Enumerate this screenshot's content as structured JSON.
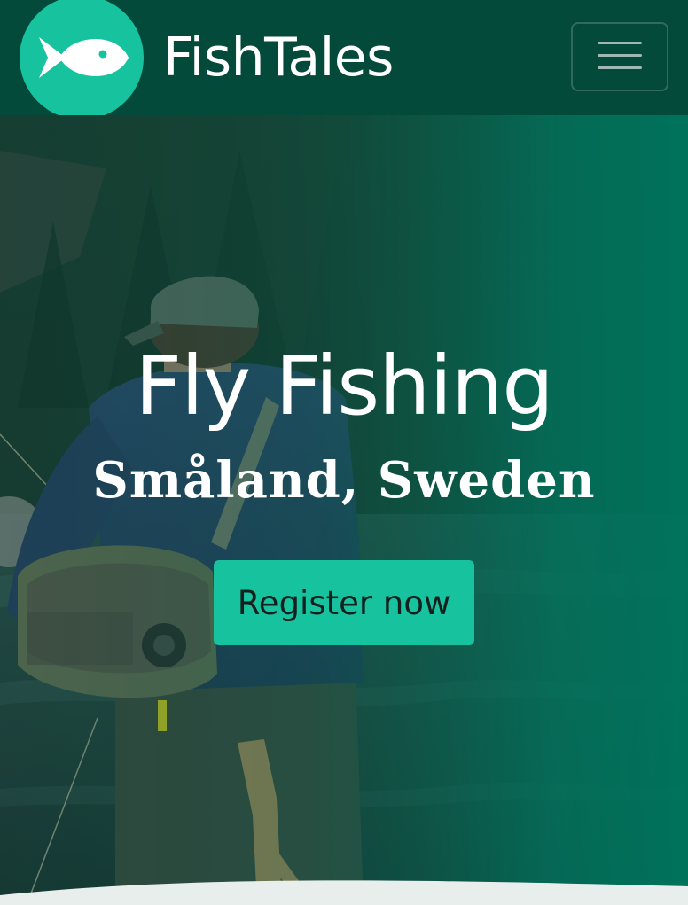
{
  "navbar": {
    "brand_name": "FishTales",
    "logo_icon": "fish-icon",
    "menu_icon": "hamburger-menu-icon"
  },
  "hero": {
    "background_image": "fly-fisherman-in-river-photo",
    "title": "Fly Fishing",
    "subtitle": "Småland, Sweden",
    "cta_label": "Register now"
  },
  "colors": {
    "navbar_bg": "#044a3b",
    "logo_circle": "#17c29e",
    "cta_bg": "#17c29e",
    "overlay_teal": "#007a62",
    "text_light": "#ffffff",
    "cta_text": "#14201d"
  }
}
